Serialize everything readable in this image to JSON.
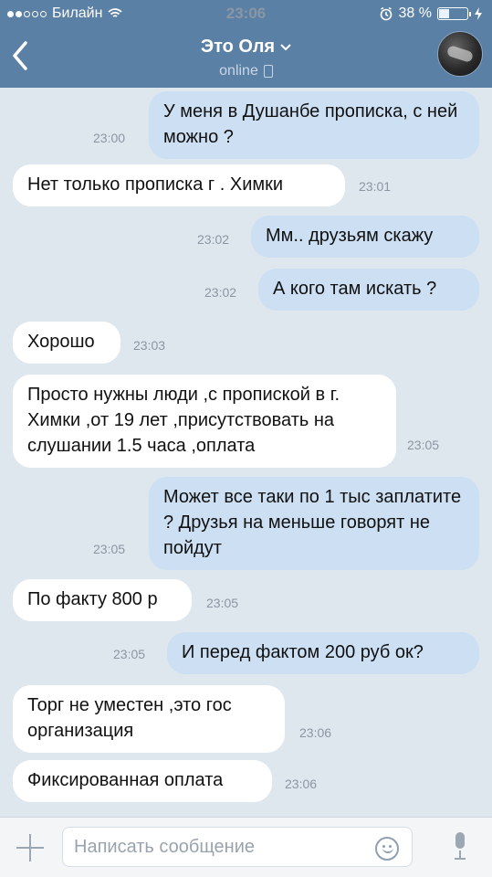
{
  "status_bar": {
    "carrier": "Билайн",
    "time": "23:06",
    "battery_percent": "38 %",
    "battery_level": 0.38,
    "icons": [
      "signal-dots",
      "wifi-icon",
      "alarm-clock-icon",
      "battery-icon",
      "charging-bolt-icon"
    ]
  },
  "header": {
    "title": "Это Оля",
    "subtitle": "online",
    "icons": [
      "back-chevron-icon",
      "chevron-down-icon",
      "mobile-phone-icon",
      "avatar"
    ]
  },
  "messages": [
    {
      "dir": "out",
      "text": "У меня в Душанбе прописка, с ней можно ?",
      "time": "23:00"
    },
    {
      "dir": "in",
      "text": "Нет только прописка г . Химки",
      "time": "23:01"
    },
    {
      "dir": "out",
      "text": "Мм.. друзьям скажу",
      "time": "23:02"
    },
    {
      "dir": "out",
      "text": "А кого там искать ?",
      "time": "23:02"
    },
    {
      "dir": "in",
      "text": "Хорошо",
      "time": "23:03"
    },
    {
      "dir": "in",
      "text": "Просто нужны люди ,с пропиской в г. Химки ,от 19 лет ,присутствовать на слушании 1.5 часа ,оплата",
      "time": "23:05"
    },
    {
      "dir": "out",
      "text": "Может все таки по 1 тыс заплатите ? Друзья на меньше говорят не пойдут",
      "time": "23:05"
    },
    {
      "dir": "in",
      "text": "По факту 800 р",
      "time": "23:05"
    },
    {
      "dir": "out",
      "text": "И перед фактом 200 руб ок?",
      "time": "23:05"
    },
    {
      "dir": "in",
      "text": "Торг не уместен ,это гос организация",
      "time": "23:06"
    },
    {
      "dir": "in",
      "text": "Фиксированная оплата",
      "time": "23:06"
    }
  ],
  "composer": {
    "placeholder": "Написать сообщение",
    "icons": [
      "plus-icon",
      "emoji-icon",
      "microphone-icon"
    ]
  }
}
